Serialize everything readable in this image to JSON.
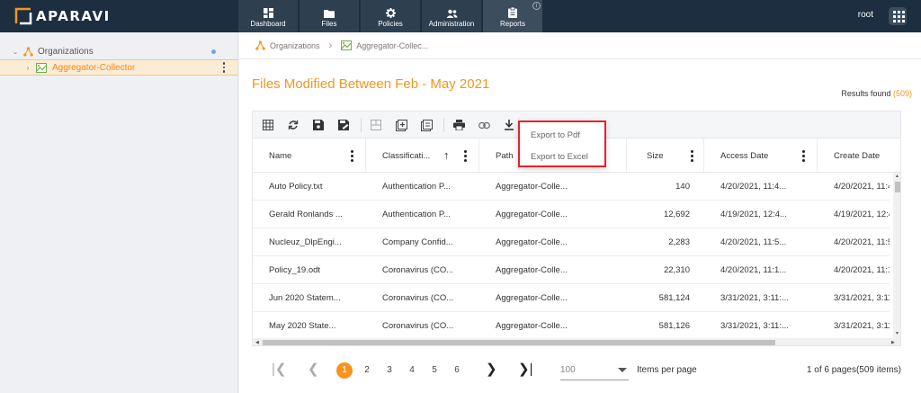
{
  "app": {
    "logo_text": "APARAVI",
    "user": "root"
  },
  "nav": [
    {
      "label": "Dashboard",
      "icon": "dashboard-icon"
    },
    {
      "label": "Files",
      "icon": "folder-icon"
    },
    {
      "label": "Policies",
      "icon": "gear-icon"
    },
    {
      "label": "Administration",
      "icon": "users-icon"
    },
    {
      "label": "Reports",
      "icon": "clipboard-icon",
      "active": true
    }
  ],
  "sidebar": {
    "items": [
      {
        "label": "Organizations"
      },
      {
        "label": "Aggregator-Collector",
        "selected": true
      }
    ]
  },
  "breadcrumb": {
    "root": "Organizations",
    "current": "Aggregator-Collec..."
  },
  "report": {
    "title": "Files Modified Between Feb - May 2021",
    "results_label": "Results found",
    "results_count": "(509)"
  },
  "export_menu": {
    "items": [
      "Export to Pdf",
      "Export to Excel"
    ]
  },
  "table": {
    "columns": [
      "Name",
      "Classificati...",
      "Path",
      "Size",
      "Access Date",
      "Create Date"
    ],
    "rows": [
      [
        "Auto Policy.txt",
        "Authentication P...",
        "Aggregator-Colle...",
        "140",
        "4/20/2021, 11:4...",
        "4/20/2021, 11:4"
      ],
      [
        "Gerald Ronlands ...",
        "Authentication P...",
        "Aggregator-Colle...",
        "12,692",
        "4/19/2021, 12:4...",
        "4/19/2021, 12:4"
      ],
      [
        "Nucleuz_DlpEngi...",
        "Company Confid...",
        "Aggregator-Colle...",
        "2,283",
        "4/20/2021, 11:5...",
        "4/20/2021, 11:5"
      ],
      [
        "Policy_19.odt",
        "Coronavirus (CO...",
        "Aggregator-Colle...",
        "22,310",
        "4/20/2021, 11:1...",
        "4/20/2021, 11:1"
      ],
      [
        "Jun 2020 Statem...",
        "Coronavirus (CO...",
        "Aggregator-Colle...",
        "581,124",
        "3/31/2021, 3:11:...",
        "3/31/2021, 3:11"
      ],
      [
        "May 2020 State...",
        "Coronavirus (CO...",
        "Aggregator-Colle...",
        "581,126",
        "3/31/2021, 3:11:...",
        "3/31/2021, 3:11"
      ]
    ]
  },
  "pager": {
    "pages": [
      "1",
      "2",
      "3",
      "4",
      "5",
      "6"
    ],
    "current": "1",
    "per_page": "100",
    "per_page_label": "Items per page",
    "info": "1 of 6 pages(509 items)"
  },
  "colors": {
    "accent": "#f5941f",
    "topbar": "#1c2e40",
    "highlight_border": "#e0242d"
  }
}
